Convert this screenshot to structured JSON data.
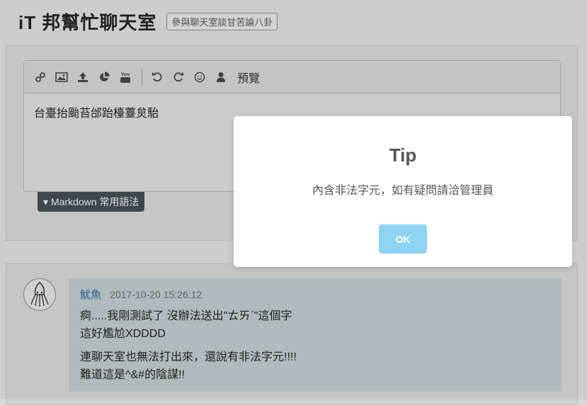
{
  "header": {
    "title": "iT 邦幫忙聊天室",
    "subtitle": "參與聊天室談甘苦論八卦"
  },
  "editor": {
    "toolbar": {
      "icons": [
        "link-icon",
        "image-icon",
        "upload-icon",
        "chart-icon",
        "youtube-icon",
        "undo-icon",
        "redo-icon",
        "emoji-icon",
        "user-icon"
      ],
      "preview_label": "預覽"
    },
    "content": "台臺抬颱苔邰跆檯薹炱駘",
    "markdown_tab_label": "Markdown 常用語法"
  },
  "message": {
    "user": "魷魚",
    "time": "2017-10-20 15:26:12",
    "lines": [
      "痾.....我剛測試了 沒辦法送出\"ㄊㄞˊ\"這個字",
      "這好尷尬XDDDD",
      "連聊天室也無法打出來，還說有非法字元!!!!",
      "難道這是^&#的陰謀!!"
    ]
  },
  "modal": {
    "title": "Tip",
    "text": "內含非法字元，如有疑問請洽管理員",
    "ok_label": "OK"
  },
  "colors": {
    "ok_button": "#8ed4f2",
    "username": "#2a6496",
    "markdown_tab": "#3f4a52"
  }
}
